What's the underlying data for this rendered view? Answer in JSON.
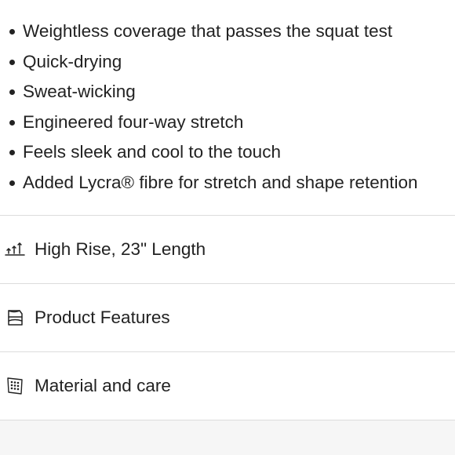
{
  "features": [
    "Weightless coverage that passes the squat test",
    "Quick-drying",
    "Sweat-wicking",
    "Engineered four-way stretch",
    "Feels sleek and cool to the touch",
    "Added Lycra® fibre for stretch and shape retention"
  ],
  "sections": [
    {
      "label": "High Rise, 23\" Length",
      "icon": "rise-length-icon"
    },
    {
      "label": "Product Features",
      "icon": "product-features-icon"
    },
    {
      "label": "Material and care",
      "icon": "material-care-icon"
    }
  ],
  "colors": {
    "text": "#222222",
    "divider": "#dcdcdc",
    "footer": "#f6f6f6"
  }
}
